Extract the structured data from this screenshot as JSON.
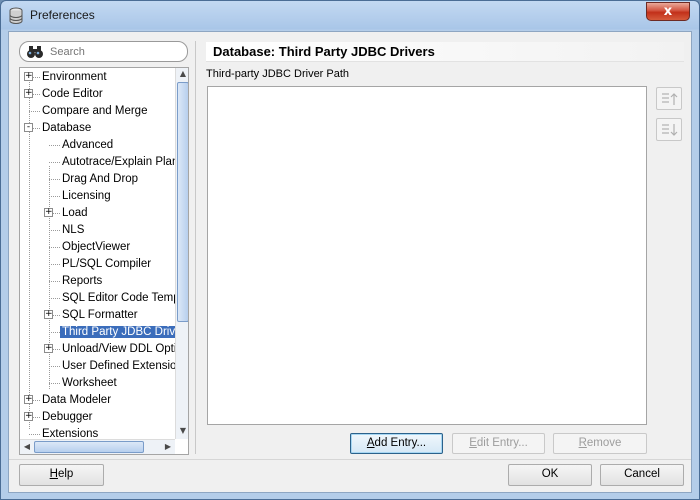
{
  "window": {
    "title": "Preferences",
    "close_symbol": "x"
  },
  "search": {
    "placeholder": "Search"
  },
  "tree": {
    "items": [
      {
        "label": "Environment",
        "expander": "+"
      },
      {
        "label": "Code Editor",
        "expander": "+"
      },
      {
        "label": "Compare and Merge",
        "expander": ""
      },
      {
        "label": "Database",
        "expander": "-"
      },
      {
        "label": "Advanced",
        "expander": ""
      },
      {
        "label": "Autotrace/Explain Plan",
        "expander": ""
      },
      {
        "label": "Drag And Drop",
        "expander": ""
      },
      {
        "label": "Licensing",
        "expander": ""
      },
      {
        "label": "Load",
        "expander": "+"
      },
      {
        "label": "NLS",
        "expander": ""
      },
      {
        "label": "ObjectViewer",
        "expander": ""
      },
      {
        "label": "PL/SQL Compiler",
        "expander": ""
      },
      {
        "label": "Reports",
        "expander": ""
      },
      {
        "label": "SQL Editor Code Templates",
        "expander": ""
      },
      {
        "label": "SQL Formatter",
        "expander": "+"
      },
      {
        "label": "Third Party JDBC Drivers",
        "expander": "",
        "selected": true
      },
      {
        "label": "Unload/View DDL Options",
        "expander": "+"
      },
      {
        "label": "User Defined Extensions",
        "expander": ""
      },
      {
        "label": "Worksheet",
        "expander": ""
      },
      {
        "label": "Data Modeler",
        "expander": "+"
      },
      {
        "label": "Debugger",
        "expander": "+"
      },
      {
        "label": "Extensions",
        "expander": ""
      }
    ]
  },
  "page": {
    "title": "Database: Third Party JDBC Drivers",
    "section_label": "Third-party JDBC Driver Path"
  },
  "side_buttons": {
    "move_up_icon": "move-up-icon",
    "move_down_icon": "move-down-icon"
  },
  "buttons": {
    "add_entry": {
      "pre": "",
      "ul": "A",
      "post": "dd Entry..."
    },
    "edit_entry": {
      "pre": "",
      "ul": "E",
      "post": "dit Entry..."
    },
    "remove": {
      "pre": "",
      "ul": "R",
      "post": "emove"
    },
    "help": {
      "pre": "",
      "ul": "H",
      "post": "elp"
    },
    "ok": {
      "label": "OK"
    },
    "cancel": {
      "label": "Cancel"
    }
  }
}
